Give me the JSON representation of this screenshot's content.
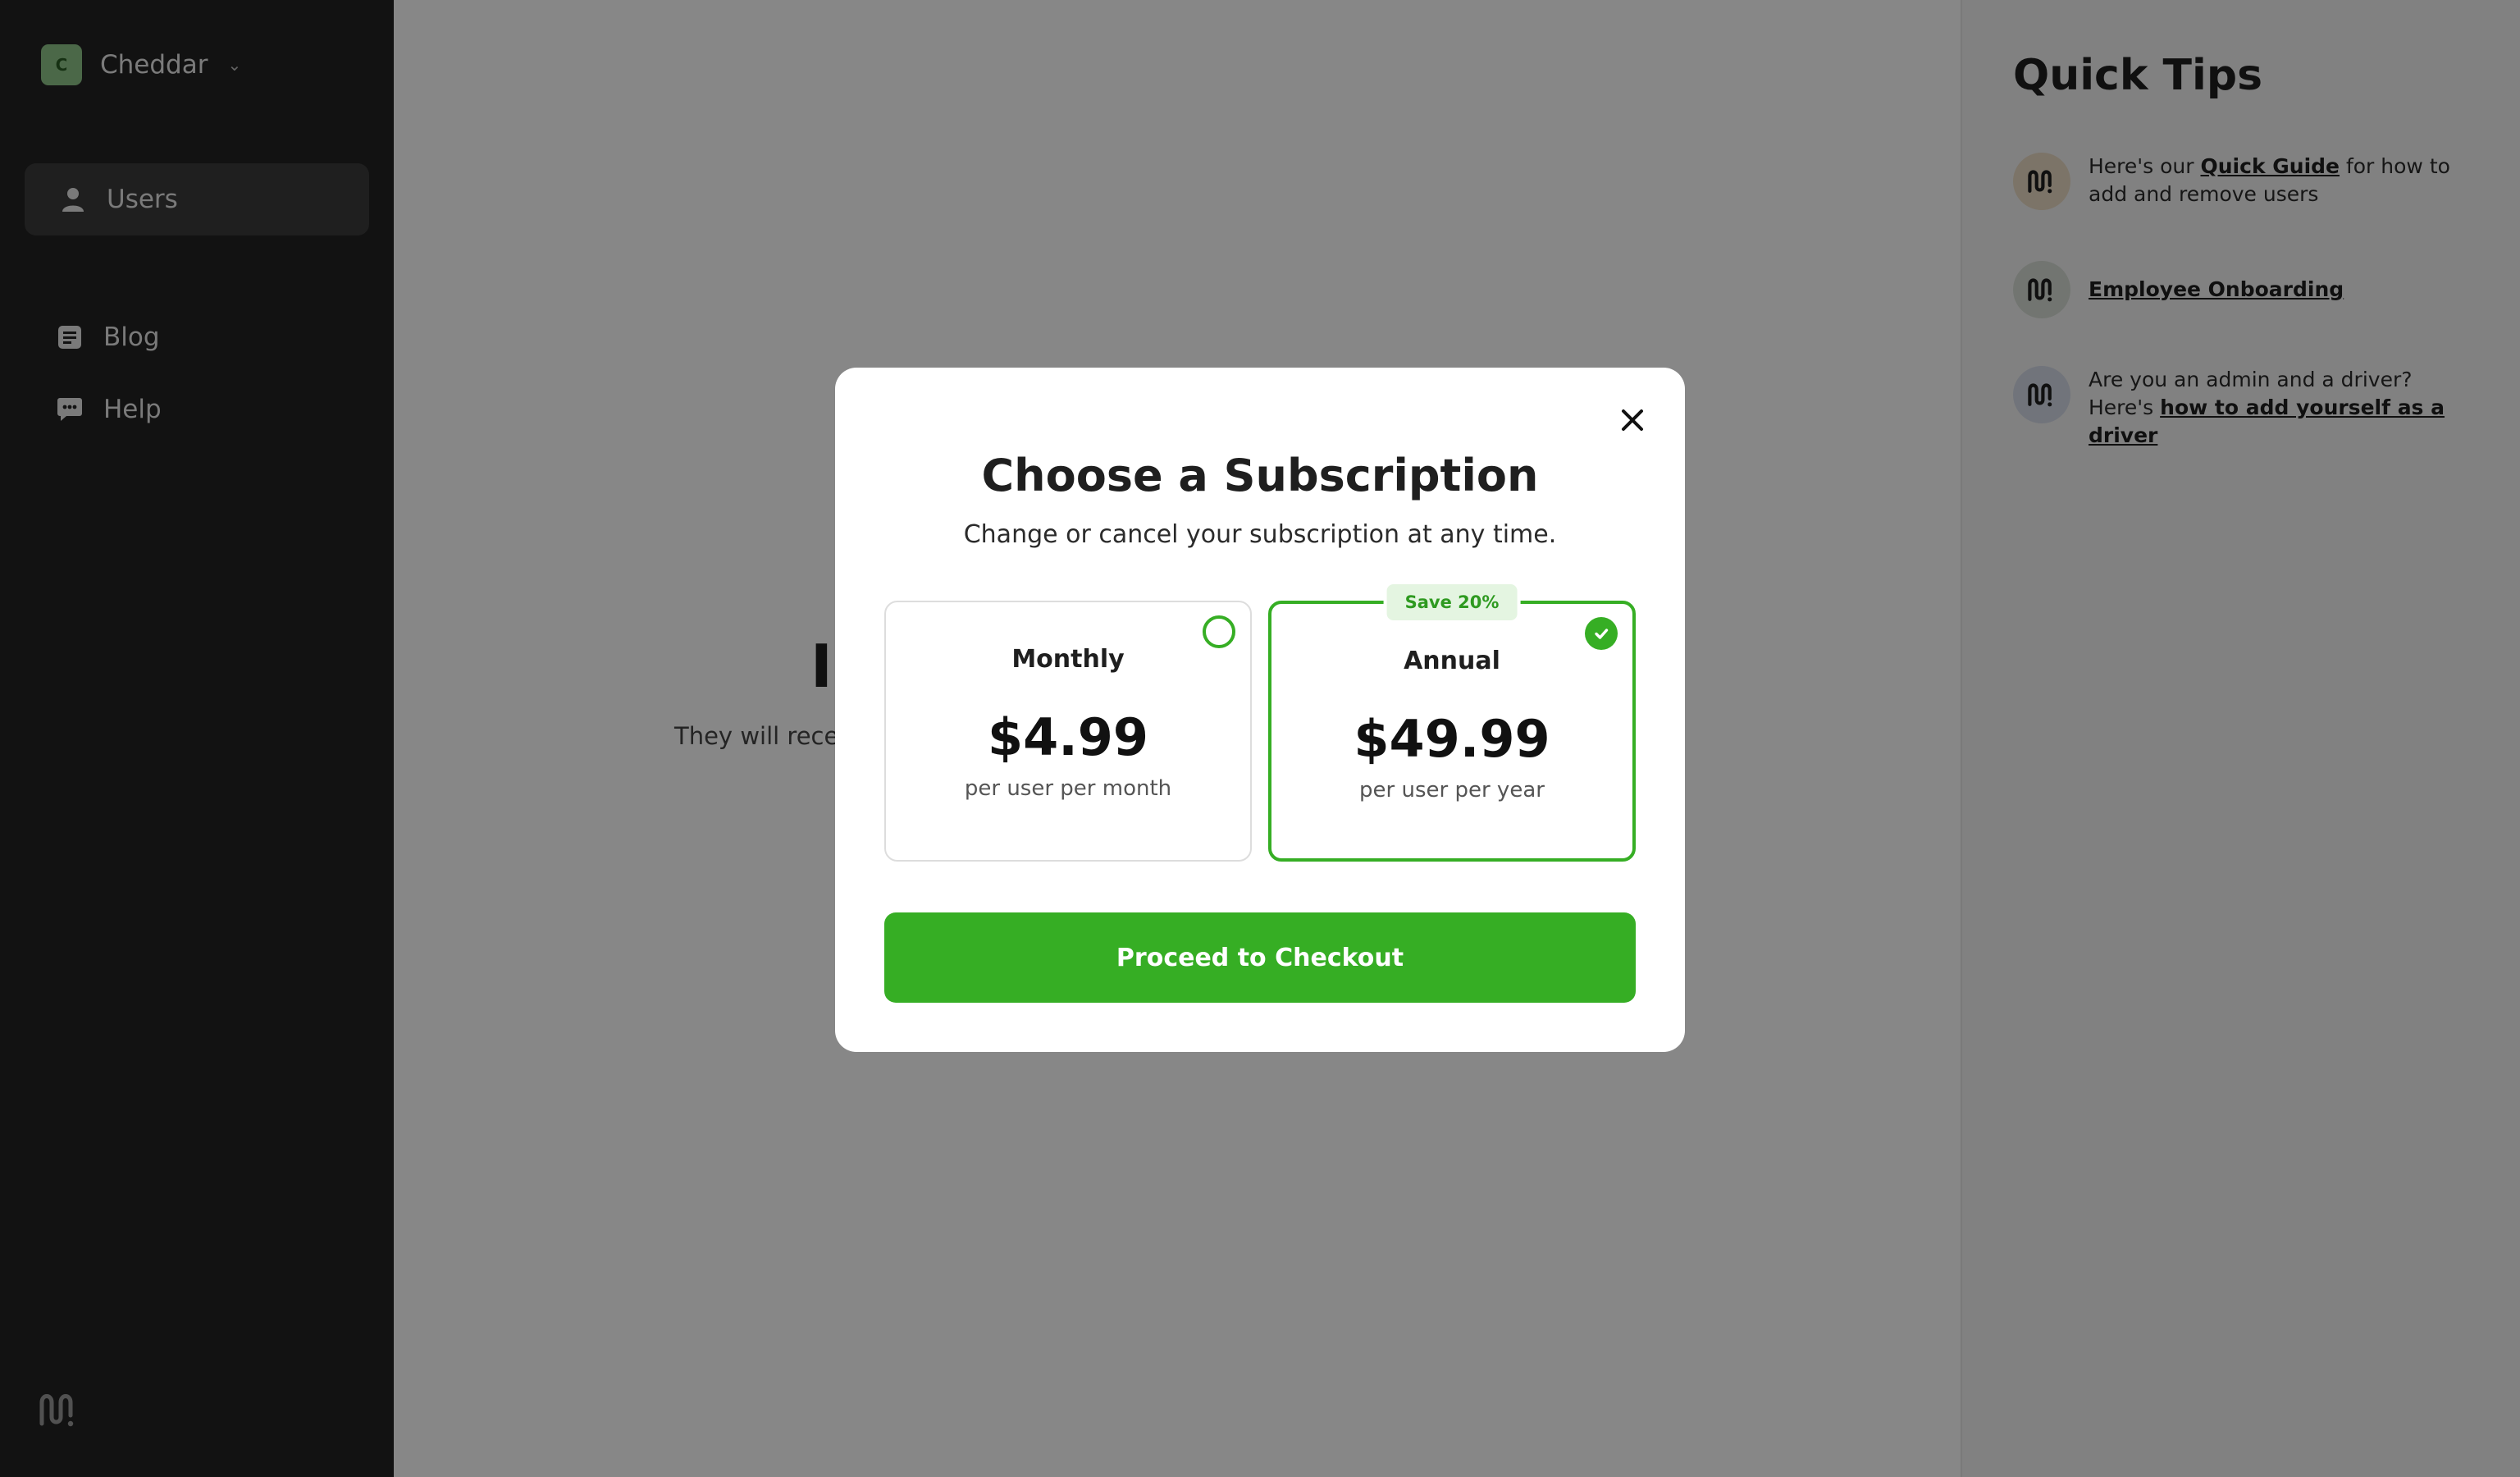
{
  "sidebar": {
    "workspace": {
      "initial": "C",
      "name": "Cheddar"
    },
    "nav": {
      "users": "Users",
      "blog": "Blog",
      "help": "Help"
    }
  },
  "main": {
    "heading_partial": "In",
    "subtext_partial": "They will recei"
  },
  "tips": {
    "title": "Quick Tips",
    "items": [
      {
        "prefix": "Here's our ",
        "link": "Quick Guide",
        "suffix": " for how to add and remove users"
      },
      {
        "link": "Employee Onboarding"
      },
      {
        "prefix": "Are you an admin and a driver? Here's ",
        "link": "how to add yourself as a driver"
      }
    ]
  },
  "modal": {
    "title": "Choose a Subscription",
    "subtitle": "Change or cancel your subscription at any time.",
    "plans": [
      {
        "name": "Monthly",
        "price": "$4.99",
        "period": "per user per month",
        "selected": false
      },
      {
        "name": "Annual",
        "price": "$49.99",
        "period": "per user per year",
        "selected": true,
        "badge": "Save 20%"
      }
    ],
    "checkout_label": "Proceed to Checkout"
  },
  "colors": {
    "accent": "#36ae24",
    "sidebar_bg": "#222222",
    "badge_bg": "#e4f5e1"
  }
}
